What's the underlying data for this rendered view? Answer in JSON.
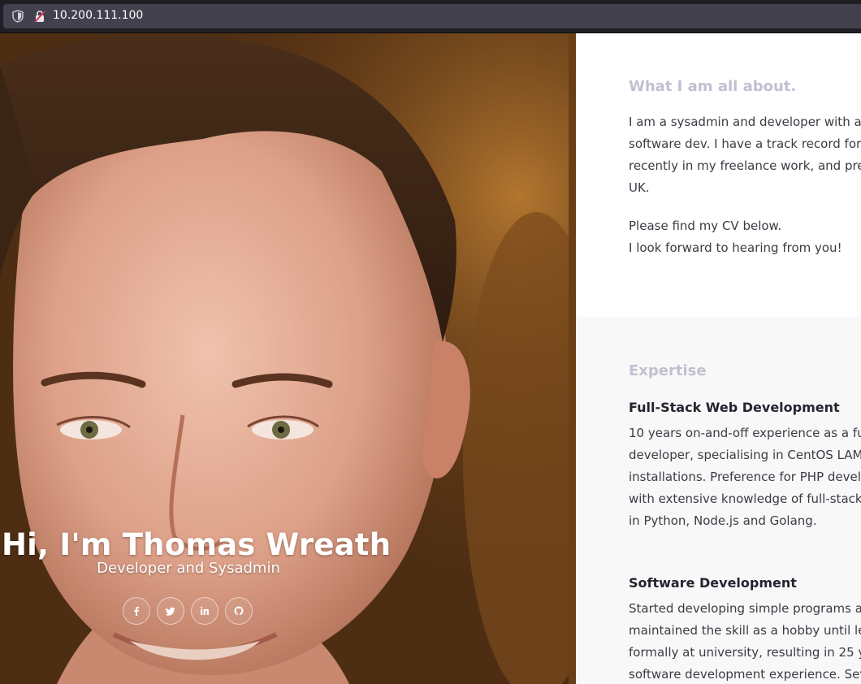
{
  "browser": {
    "url": "10.200.111.100"
  },
  "hero": {
    "title": "Hi, I'm Thomas Wreath",
    "subtitle": "Developer and Sysadmin",
    "social": [
      {
        "icon": "facebook-icon",
        "glyph": "f"
      },
      {
        "icon": "twitter-icon",
        "glyph": ""
      },
      {
        "icon": "linkedin-icon",
        "glyph": "in"
      },
      {
        "icon": "github-icon",
        "glyph": ""
      }
    ]
  },
  "about": {
    "heading": "What I am all about.",
    "lines": [
      "I am a sysadmin and developer with a",
      "software dev. I have a track record for",
      "recently in my freelance work, and pre",
      "UK."
    ],
    "closing_lines": [
      "Please find my CV below.",
      "I look forward to hearing from you!"
    ]
  },
  "expertise": {
    "heading": "Expertise",
    "items": [
      {
        "title": "Full-Stack Web Development",
        "lines": [
          "10 years on-and-off experience as a fu",
          "developer, specialising in CentOS LAM",
          "installations. Preference for PHP devel",
          "with extensive knowledge of full-stack",
          "in Python, Node.js and Golang."
        ]
      },
      {
        "title": "Software Development",
        "lines": [
          "Started developing simple programs a",
          "maintained the skill as a hobby until le",
          "formally at university, resulting in 25 y",
          "software development experience. Sev"
        ]
      }
    ]
  },
  "colors": {
    "heading_muted": "#c1c0d0",
    "body_text": "#3b3b44",
    "subheading": "#25242e",
    "panel_alt_bg": "#f8f8f9"
  }
}
